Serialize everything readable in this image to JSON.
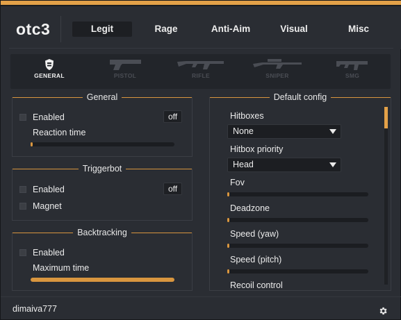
{
  "app": {
    "logo": "otc3"
  },
  "tabs": [
    {
      "label": "Legit",
      "active": true
    },
    {
      "label": "Rage"
    },
    {
      "label": "Anti-Aim"
    },
    {
      "label": "Visual"
    },
    {
      "label": "Misc"
    }
  ],
  "weapons": [
    {
      "label": "GENERAL",
      "icon": "shield-icon",
      "active": true
    },
    {
      "label": "PISTOL",
      "icon": "pistol-icon"
    },
    {
      "label": "RIFLE",
      "icon": "rifle-icon"
    },
    {
      "label": "SNIPER",
      "icon": "sniper-icon"
    },
    {
      "label": "SMG",
      "icon": "smg-icon"
    }
  ],
  "general": {
    "title": "General",
    "enabled_label": "Enabled",
    "enabled_checked": false,
    "enabled_key": "off",
    "reaction_label": "Reaction time",
    "reaction_value": 0.0
  },
  "triggerbot": {
    "title": "Triggerbot",
    "enabled_label": "Enabled",
    "enabled_checked": false,
    "enabled_key": "off",
    "magnet_label": "Magnet",
    "magnet_checked": false
  },
  "backtracking": {
    "title": "Backtracking",
    "enabled_label": "Enabled",
    "enabled_checked": false,
    "max_time_label": "Maximum time",
    "max_time_value": 1.0
  },
  "default_config": {
    "title": "Default config",
    "hitboxes_label": "Hitboxes",
    "hitboxes_value": "None",
    "priority_label": "Hitbox priority",
    "priority_value": "Head",
    "fov_label": "Fov",
    "fov_value": 0.0,
    "deadzone_label": "Deadzone",
    "deadzone_value": 0.0,
    "speed_yaw_label": "Speed (yaw)",
    "speed_yaw_value": 0.0,
    "speed_pitch_label": "Speed (pitch)",
    "speed_pitch_value": 0.0,
    "recoil_label": "Recoil control"
  },
  "footer": {
    "username": "dimaiva777",
    "settings_icon": "gear-icon"
  },
  "colors": {
    "accent": "#e3a148",
    "background": "#2a2d33",
    "panel": "#22252a"
  }
}
